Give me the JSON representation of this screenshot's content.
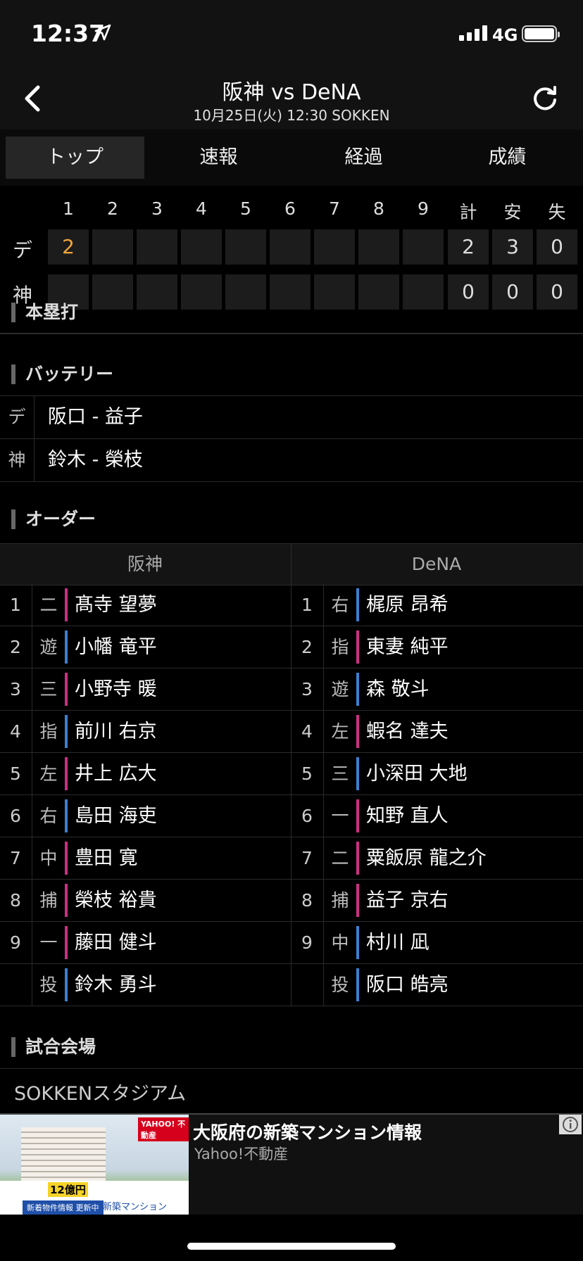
{
  "status": {
    "time": "12:37",
    "network": "4G"
  },
  "header": {
    "title": "阪神 vs DeNA",
    "subtitle": "10月25日(火) 12:30 SOKKEN"
  },
  "tabs": [
    "トップ",
    "速報",
    "経過",
    "成績"
  ],
  "scoreboard": {
    "innings": [
      "1",
      "2",
      "3",
      "4",
      "5",
      "6",
      "7",
      "8",
      "9"
    ],
    "totals_headers": [
      "計",
      "安",
      "失"
    ],
    "rows": [
      {
        "team": "デ",
        "innings": [
          "2",
          "",
          "",
          "",
          "",
          "",
          "",
          "",
          ""
        ],
        "totals": [
          "2",
          "3",
          "0"
        ]
      },
      {
        "team": "神",
        "innings": [
          "",
          "",
          "",
          "",
          "",
          "",
          "",
          "",
          ""
        ],
        "totals": [
          "0",
          "0",
          "0"
        ]
      }
    ]
  },
  "sections": {
    "homerun": "本塁打",
    "battery": "バッテリー",
    "order": "オーダー",
    "venue": "試合会場"
  },
  "battery": [
    {
      "side": "デ",
      "names": "阪口 - 益子"
    },
    {
      "side": "神",
      "names": "鈴木 - 榮枝"
    }
  ],
  "order": {
    "home_team": "阪神",
    "away_team": "DeNA",
    "home": [
      {
        "num": "1",
        "pos": "二",
        "name": "髙寺 望夢",
        "bat": "R"
      },
      {
        "num": "2",
        "pos": "遊",
        "name": "小幡 竜平",
        "bat": "L"
      },
      {
        "num": "3",
        "pos": "三",
        "name": "小野寺 暖",
        "bat": "R"
      },
      {
        "num": "4",
        "pos": "指",
        "name": "前川 右京",
        "bat": "L"
      },
      {
        "num": "5",
        "pos": "左",
        "name": "井上 広大",
        "bat": "R"
      },
      {
        "num": "6",
        "pos": "右",
        "name": "島田 海吏",
        "bat": "L"
      },
      {
        "num": "7",
        "pos": "中",
        "name": "豊田 寛",
        "bat": "R"
      },
      {
        "num": "8",
        "pos": "捕",
        "name": "榮枝 裕貴",
        "bat": "R"
      },
      {
        "num": "9",
        "pos": "一",
        "name": "藤田 健斗",
        "bat": "R"
      },
      {
        "num": "",
        "pos": "投",
        "name": "鈴木 勇斗",
        "bat": "L"
      }
    ],
    "away": [
      {
        "num": "1",
        "pos": "右",
        "name": "梶原 昂希",
        "bat": "L"
      },
      {
        "num": "2",
        "pos": "指",
        "name": "東妻 純平",
        "bat": "R"
      },
      {
        "num": "3",
        "pos": "遊",
        "name": "森 敬斗",
        "bat": "L"
      },
      {
        "num": "4",
        "pos": "左",
        "name": "蝦名 達夫",
        "bat": "R"
      },
      {
        "num": "5",
        "pos": "三",
        "name": "小深田 大地",
        "bat": "L"
      },
      {
        "num": "6",
        "pos": "一",
        "name": "知野 直人",
        "bat": "R"
      },
      {
        "num": "7",
        "pos": "二",
        "name": "粟飯原 龍之介",
        "bat": "R"
      },
      {
        "num": "8",
        "pos": "捕",
        "name": "益子 京右",
        "bat": "R"
      },
      {
        "num": "9",
        "pos": "中",
        "name": "村川 凪",
        "bat": "L"
      },
      {
        "num": "",
        "pos": "投",
        "name": "阪口 皓亮",
        "bat": "L"
      }
    ]
  },
  "venue": "SOKKENスタジアム",
  "ad": {
    "title": "大阪府の新築マンション情報",
    "sponsor": "Yahoo!不動産",
    "image_tag": "YAHOO! 不動産",
    "image_big": "12億円",
    "image_strip": "新着物件情報 更新中",
    "image_strip2": "新築マンション"
  },
  "colors": {
    "right_handed": "#cc2f84",
    "left_handed": "#3d7fd1",
    "accent": "#f2a63b"
  }
}
